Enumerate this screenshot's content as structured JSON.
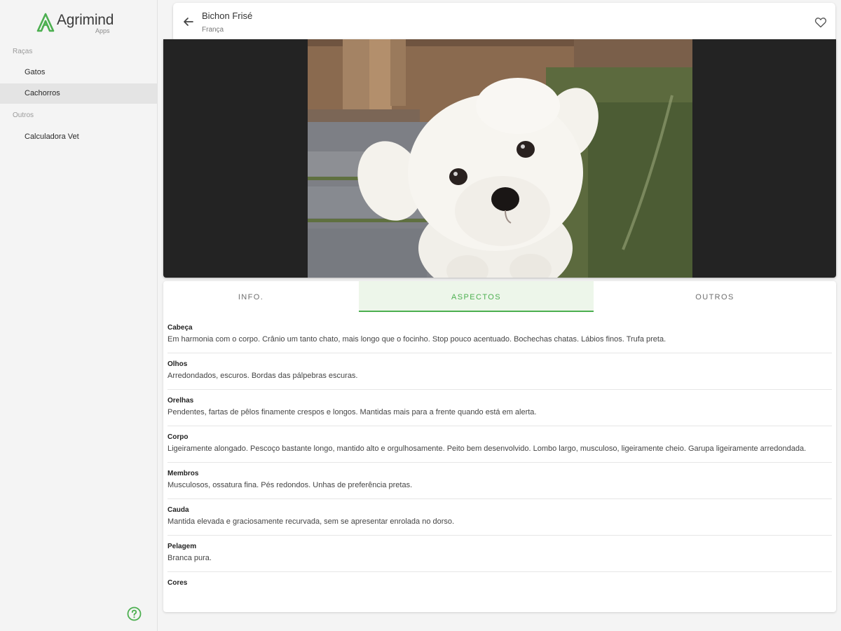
{
  "brand": {
    "name": "Agrimind",
    "sub": "Apps"
  },
  "sidebar": {
    "sections": [
      {
        "label": "Raças",
        "items": [
          {
            "label": "Gatos",
            "active": false
          },
          {
            "label": "Cachorros",
            "active": true
          }
        ]
      },
      {
        "label": "Outros",
        "items": [
          {
            "label": "Calculadora Vet",
            "active": false
          }
        ]
      }
    ],
    "help_icon": "question-circle-icon"
  },
  "header": {
    "title": "Bichon Frisé",
    "subtitle": "França",
    "back_icon": "arrow-left-icon",
    "favorite_icon": "heart-outline-icon"
  },
  "hero": {
    "subject": "dog-photo"
  },
  "tabs": [
    {
      "label": "INFO.",
      "active": false
    },
    {
      "label": "ASPECTOS",
      "active": true
    },
    {
      "label": "OUTROS",
      "active": false
    }
  ],
  "aspects": [
    {
      "title": "Cabeça",
      "text": "Em harmonia com o corpo. Crânio um tanto chato, mais longo que o focinho. Stop pouco acentuado. Bochechas chatas. Lábios finos. Trufa preta."
    },
    {
      "title": "Olhos",
      "text": "Arredondados, escuros. Bordas das pálpebras escuras."
    },
    {
      "title": "Orelhas",
      "text": "Pendentes, fartas de pêlos finamente crespos e longos. Mantidas mais para a frente quando está em alerta."
    },
    {
      "title": "Corpo",
      "text": "Ligeiramente alongado. Pescoço bastante longo, mantido alto e orgulhosamente. Peito bem desenvolvido. Lombo largo, musculoso, ligeiramente cheio. Garupa ligeiramente arredondada."
    },
    {
      "title": "Membros",
      "text": "Musculosos, ossatura fina. Pés redondos. Unhas de preferência pretas."
    },
    {
      "title": "Cauda",
      "text": "Mantida elevada e graciosamente recurvada, sem se apresentar enrolada no dorso."
    },
    {
      "title": "Pelagem",
      "text": "Branca pura."
    },
    {
      "title": "Cores",
      "text": ""
    }
  ],
  "colors": {
    "accent": "#4caf50",
    "accent_bg": "#edf6ea",
    "sidebar_bg": "#f4f4f4",
    "nav_active_bg": "#e4e4e4"
  }
}
